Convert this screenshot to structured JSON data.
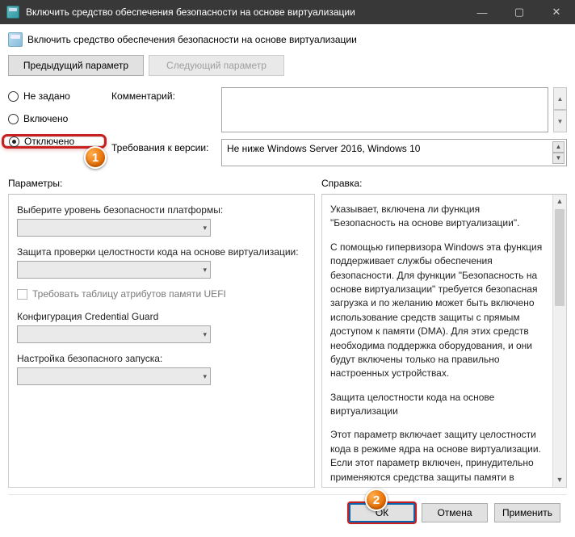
{
  "window": {
    "title": "Включить средство обеспечения безопасности на основе виртуализации"
  },
  "header": {
    "title": "Включить средство обеспечения безопасности на основе виртуализации"
  },
  "nav": {
    "prev": "Предыдущий параметр",
    "next": "Следующий параметр"
  },
  "radios": {
    "not_configured": "Не задано",
    "enabled": "Включено",
    "disabled": "Отключено",
    "selected": "disabled"
  },
  "labels": {
    "comment": "Комментарий:",
    "version_req": "Требования к версии:",
    "options": "Параметры:",
    "help": "Справка:"
  },
  "version_text": "Не ниже Windows Server 2016, Windows 10",
  "options": {
    "platform_security": "Выберите уровень безопасности платформы:",
    "code_integrity": "Защита проверки целостности кода на основе виртуализации:",
    "uefi_checkbox": "Требовать таблицу атрибутов памяти UEFI",
    "credential_guard": "Конфигурация Credential Guard",
    "secure_launch": "Настройка безопасного запуска:"
  },
  "help_paragraphs": [
    "Указывает, включена ли функция \"Безопасность на основе виртуализации\".",
    "С помощью гипервизора Windows эта функция поддерживает службы обеспечения безопасности. Для функции \"Безопасность на основе виртуализации\" требуется безопасная загрузка и по желанию может быть включено использование средств защиты с прямым доступом к памяти (DMA). Для этих средств необходима поддержка оборудования, и они будут включены только на правильно настроенных устройствах.",
    "Защита целостности кода на основе виртуализации",
    "Этот параметр включает защиту целостности кода в режиме ядра на основе виртуализации. Если этот параметр включен, принудительно применяются средства защиты памяти в режиме ядра и путь для проверки целостности кода защищен с помощью функции \"Безопасность на основе"
  ],
  "buttons": {
    "ok": "ОК",
    "cancel": "Отмена",
    "apply": "Применить"
  },
  "markers": {
    "m1": "1",
    "m2": "2"
  }
}
